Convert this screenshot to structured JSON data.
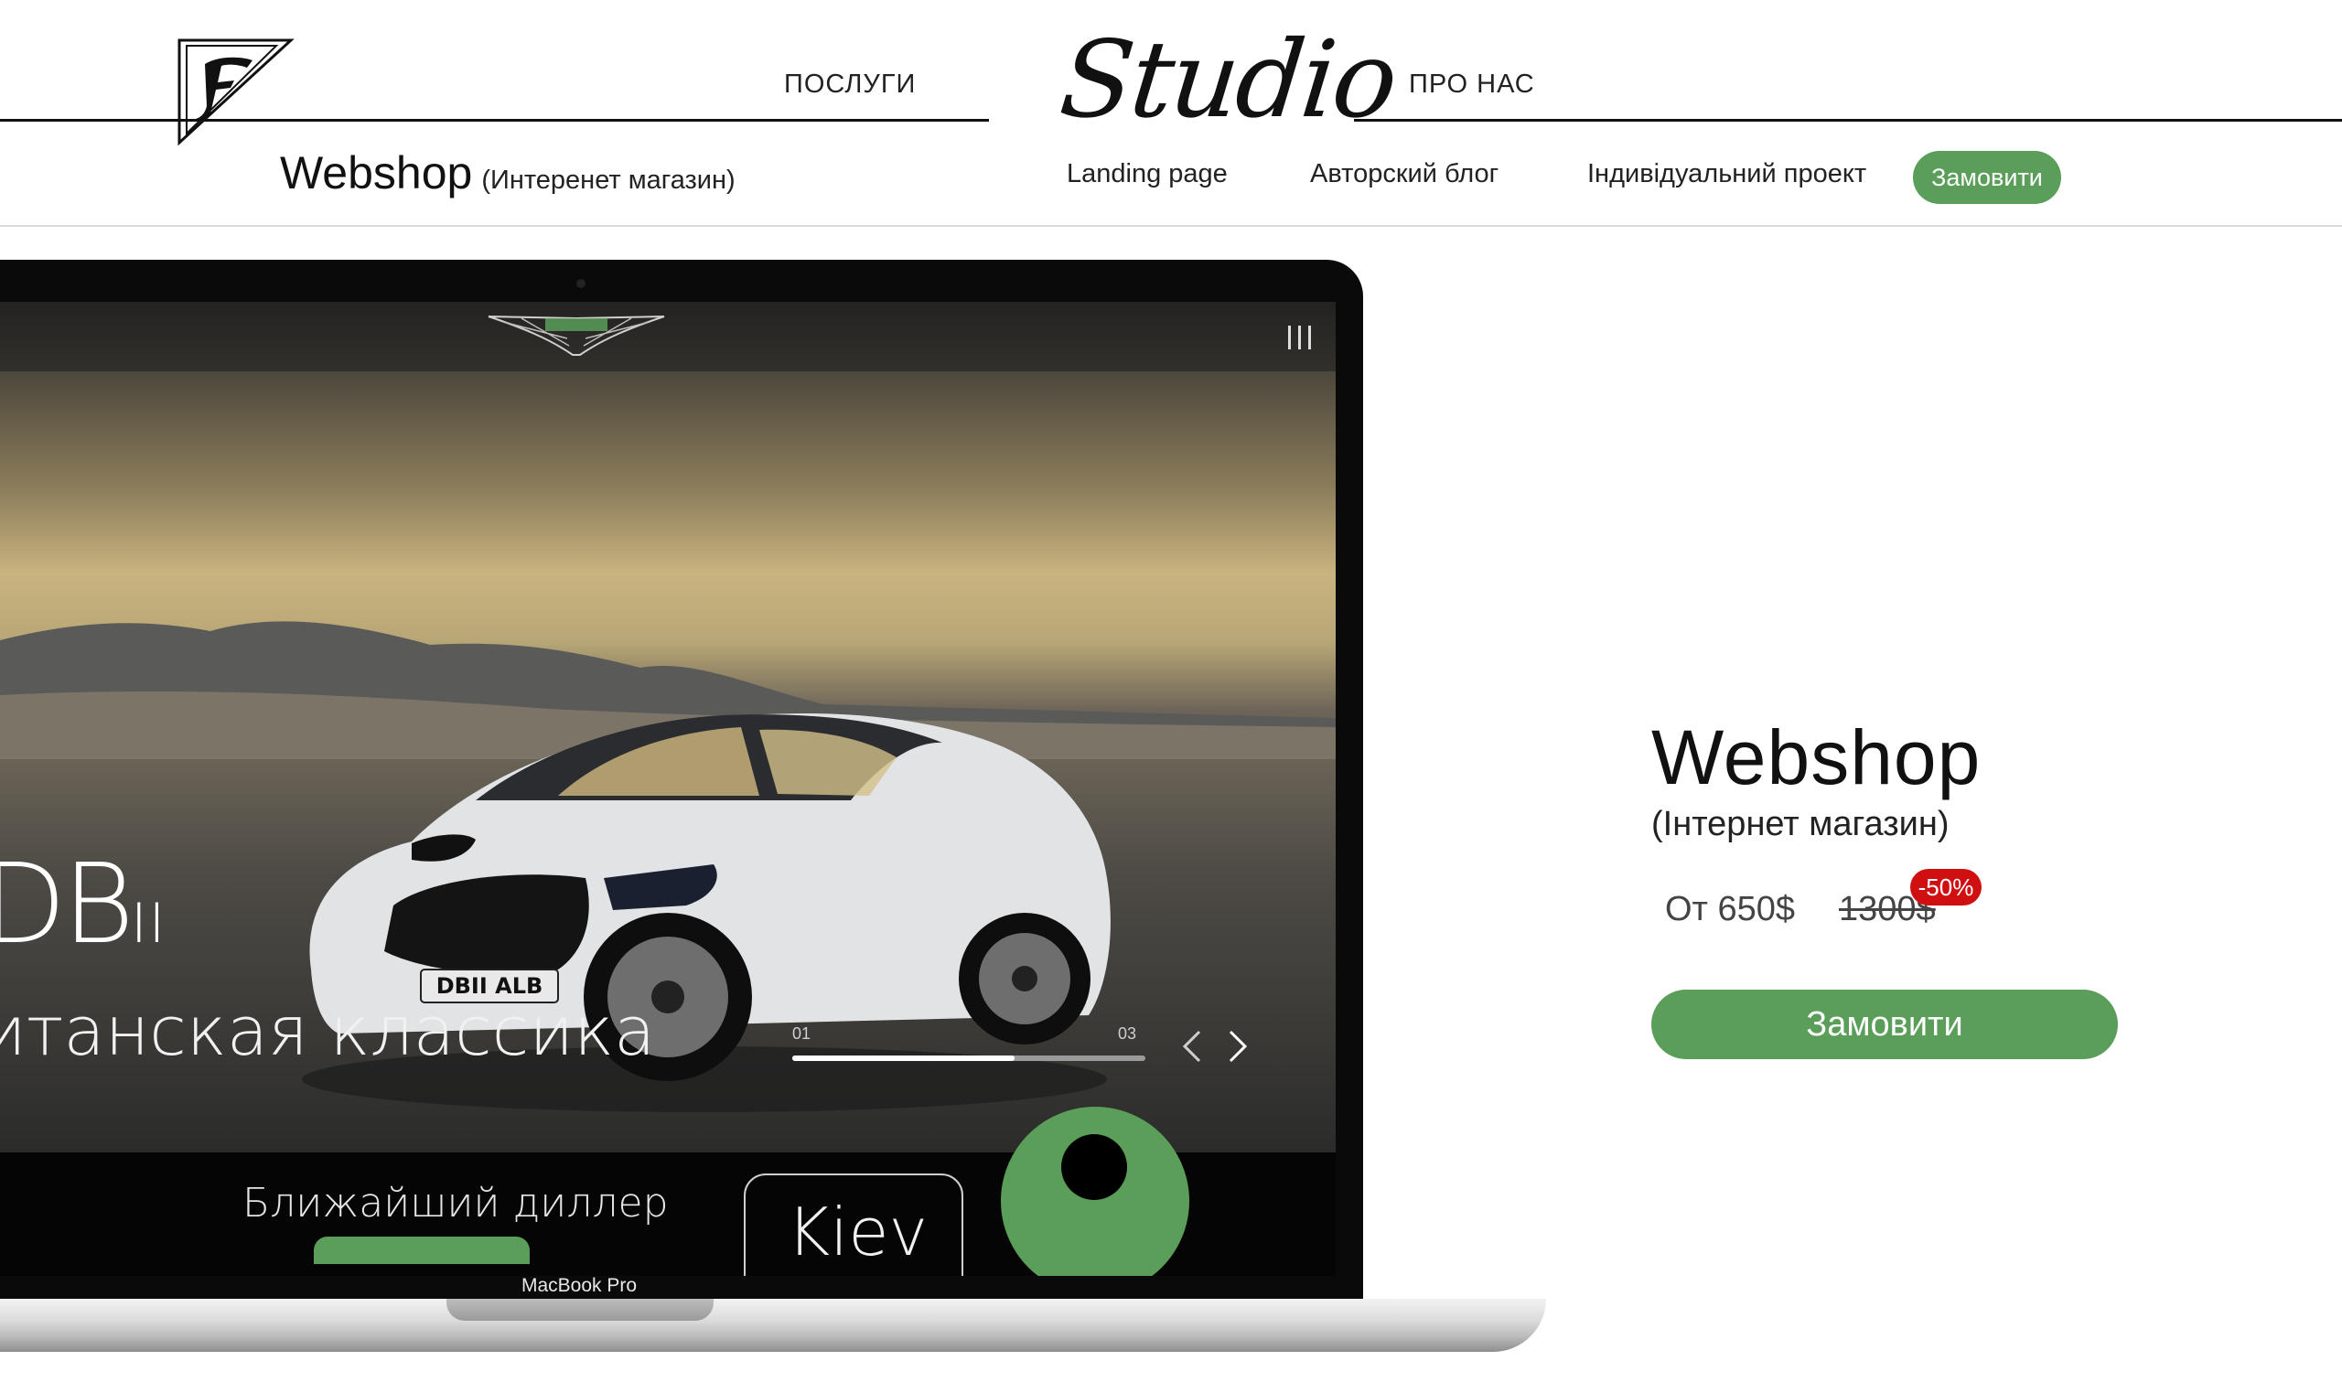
{
  "header": {
    "nav_services": "ПОСЛУГИ",
    "brand": "Studio",
    "nav_about": "ПРО НАС"
  },
  "subheader": {
    "title": "Webshop",
    "title_note": "(Интеренет магазин)",
    "links": [
      "Landing page",
      "Авторский блог",
      "Індивідуальний проект"
    ],
    "order_label": "Замовити"
  },
  "preview": {
    "model": "DB",
    "model_suffix": "II",
    "tagline": "итанская классика",
    "slide_start": "01",
    "slide_end": "03",
    "slide_progress": 0.63,
    "dealer_text": "Ближайший диллер",
    "city": "Kiev",
    "plate": "DBII ALB",
    "device_label": "MacBook Pro"
  },
  "product": {
    "title": "Webshop",
    "subtitle": "(Інтернет магазин)",
    "price": "От 650$",
    "old_price": "1300$",
    "discount": "-50%",
    "order_label": "Замовити"
  },
  "colors": {
    "accent": "#5a9e5a",
    "discount": "#d01010"
  }
}
